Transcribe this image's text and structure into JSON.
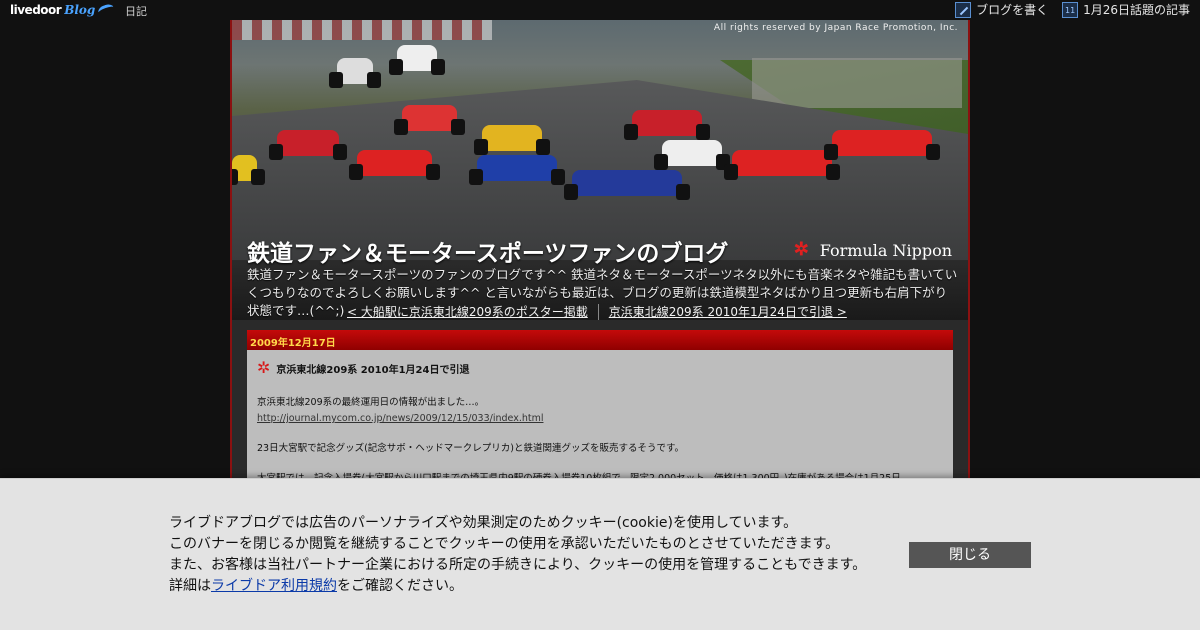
{
  "topbar": {
    "logo_text": "livedoor",
    "logo_blog": "Blog",
    "diary_label": "日記",
    "write_label": "ブログを書く",
    "topic_label": "1月26日話題の記事",
    "calendar_day": "11"
  },
  "header": {
    "copyright": "All rights reserved by Japan Race Promotion, Inc.",
    "banner_brand": "Formula Nippon",
    "title": "鉄道ファン＆モータースポーツファンのブログ",
    "description": "鉄道ファン＆モータースポーツのファンのブログです^^ 鉄道ネタ＆モータースポーツネタ以外にも音楽ネタや雑記も書いていくつもりなのでよろしくお願いします^^ と言いながらも最近は、ブログの更新は鉄道模型ネタばかり且つ更新も右肩下がり状態です…(^^;)"
  },
  "nav": {
    "prev": "< 大船駅に京浜東北線209系のポスター掲載",
    "next": "京浜東北線209系 2010年1月24日で引退 >"
  },
  "entry": {
    "date": "2009年12月17日",
    "title": "京浜東北線209系 2010年1月24日で引退",
    "line1": "京浜東北線209系の最終運用日の情報が出ました…。",
    "link": "http://journal.mycom.co.jp/news/2009/12/15/033/index.html",
    "line2": "23日大宮駅で記念グッズ(記念サボ・ヘッドマークレプリカ)と鉄道関連グッズを販売するそうです。",
    "line3": "大宮駅では、記念入場券(大宮駅から川口駅までの埼玉県内9駅の硬券入場券10枚組で、限定2,000セット、価格は1,300円。)在庫がある場合は1月25日"
  },
  "cookie": {
    "line1": "ライブドアブログでは広告のパーソナライズや効果測定のためクッキー(cookie)を使用しています。",
    "line2": "このバナーを閉じるか閲覧を継続することでクッキーの使用を承認いただいたものとさせていただきます。",
    "line3": "また、お客様は当社パートナー企業における所定の手続きにより、クッキーの使用を管理することもできます。",
    "line4_pre": "詳細は",
    "line4_link": "ライブドア利用規約",
    "line4_post": "をご確認ください。",
    "close_label": "閉じる"
  },
  "colors": {
    "accent_red": "#c40a0a",
    "date_text": "#ffd84a",
    "link_blue": "#0b3aa8"
  }
}
